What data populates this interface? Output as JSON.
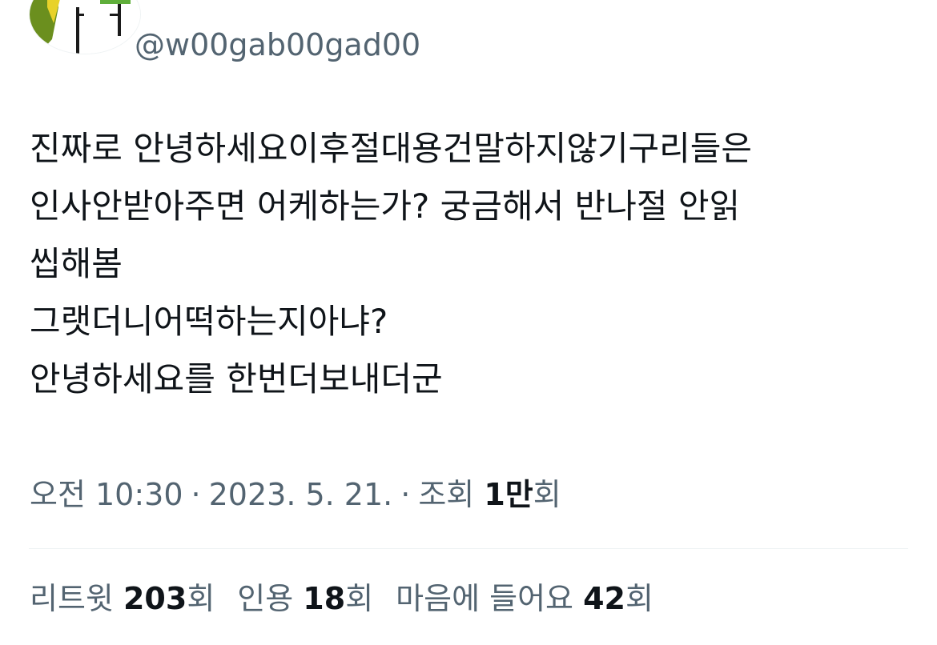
{
  "author": {
    "handle": "@w00gab00gad00"
  },
  "tweet": {
    "lines": [
      "진짜로 안녕하세요이후절대용건말하지않기구리들은",
      "인사안받아주면 어케하는가? 궁금해서 반나절 안읽",
      "씹해봄",
      "그랫더니어떡하는지아냐?",
      "안녕하세요를 한번더보내더군"
    ],
    "time": "오전 10:30",
    "separator": "·",
    "date": "2023. 5. 21.",
    "views_label": "조회",
    "views_count": "1만",
    "views_suffix": "회"
  },
  "stats": {
    "retweets_label": "리트윗",
    "retweets_count": "203",
    "retweets_suffix": "회",
    "quotes_label": "인용",
    "quotes_count": "18",
    "quotes_suffix": "회",
    "likes_label": "마음에 들어요",
    "likes_count": "42",
    "likes_suffix": "회"
  },
  "colors": {
    "text_primary": "#0f1419",
    "text_secondary": "#536471",
    "divider": "#eff3f4"
  }
}
